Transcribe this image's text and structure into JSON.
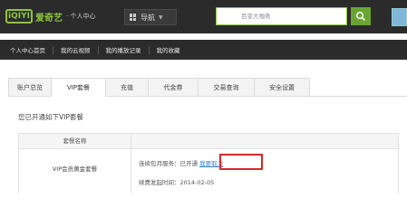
{
  "header": {
    "logo_badge": "iQIYI",
    "logo_text": "爱奇艺",
    "logo_subtitle": "· 个人中心",
    "nav_button_label": "导航",
    "search_placeholder": "百变大咖秀"
  },
  "subnav": {
    "items": [
      "个人中心首页",
      "我的云视频",
      "我的播放记录",
      "我的收藏"
    ]
  },
  "tabs": [
    {
      "label": "账户总览"
    },
    {
      "label": "VIP套餐"
    },
    {
      "label": "充值"
    },
    {
      "label": "代金券"
    },
    {
      "label": "交易查询"
    },
    {
      "label": "安全设置"
    }
  ],
  "notice": "您已开通如下VIP套餐",
  "table": {
    "header_name": "套餐名称",
    "package_name": "VIP会员黄金套餐",
    "service_label": "连续包月服务：已开通",
    "cancel_link": "我要取消",
    "renew_date": "续费发起时间：2014-02-05"
  },
  "colors": {
    "header_bg": "#2b2b2b",
    "brand_green": "#8cc63f",
    "link_blue": "#3c7fc6",
    "highlight_red": "#d32a2a"
  }
}
